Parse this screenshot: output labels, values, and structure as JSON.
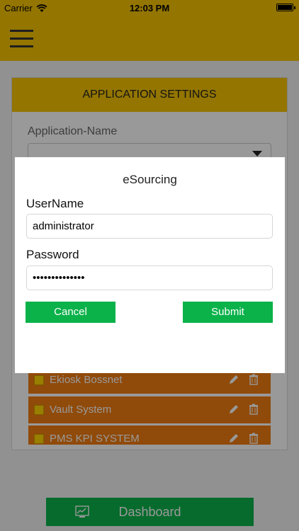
{
  "status_bar": {
    "carrier": "Carrier",
    "time": "12:03 PM",
    "wifi_icon": "wifi-icon",
    "battery_icon": "battery-icon"
  },
  "nav": {
    "menu_icon": "hamburger-menu-icon"
  },
  "settings": {
    "header": "APPLICATION SETTINGS",
    "app_name_label": "Application-Name",
    "app_select_value": ""
  },
  "applications": [
    {
      "label": "Ekiosk Bossnet"
    },
    {
      "label": "Vault System"
    },
    {
      "label": "PMS KPI SYSTEM"
    }
  ],
  "dashboard": {
    "label": "Dashboard",
    "icon": "dashboard-icon"
  },
  "dialog": {
    "title": "eSourcing",
    "username_label": "UserName",
    "username_value": "administrator",
    "password_label": "Password",
    "password_value": "••••••••••••••",
    "cancel_label": "Cancel",
    "submit_label": "Submit"
  },
  "colors": {
    "header_yellow": "#f5c400",
    "row_orange": "#f07c10",
    "button_green": "#0bb24a"
  }
}
